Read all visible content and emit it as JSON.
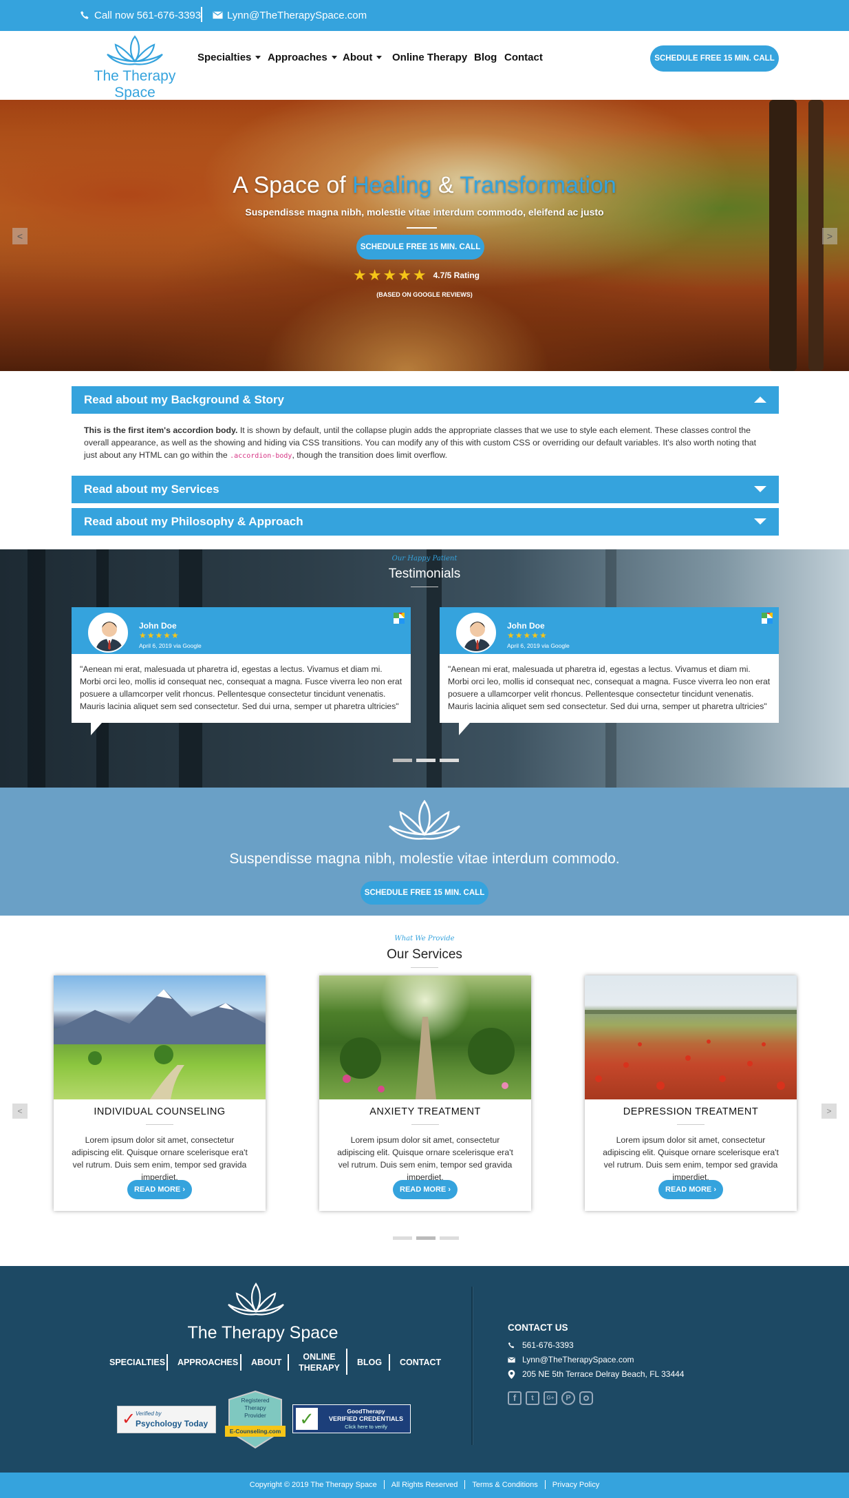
{
  "topbar": {
    "phone": "Call now 561-676-3393",
    "email": "Lynn@TheTherapySpace.com"
  },
  "header": {
    "logo_text": "The Therapy Space",
    "nav": [
      {
        "label": "Specialties",
        "dropdown": true
      },
      {
        "label": "Approaches",
        "dropdown": true
      },
      {
        "label": "About",
        "dropdown": true
      },
      {
        "label": "Online Therapy",
        "dropdown": false
      },
      {
        "label": "Blog",
        "dropdown": false
      },
      {
        "label": "Contact",
        "dropdown": false
      }
    ],
    "cta_label": "Schedule Free 15 Min. Call"
  },
  "hero": {
    "title_part1": "A Space of ",
    "title_healing": "Healing",
    "title_amp": " & ",
    "title_transformation": "Transformation",
    "subtitle": "Suspendisse magna nibh, molestie vitae interdum commodo, eleifend ac justo",
    "cta_label": "Schedule Free 15 Min. Call",
    "rating_text": "4.7/5 Rating",
    "rating_value": 4.7,
    "rating_note": "(BASED ON GOOGLE REVIEWS)"
  },
  "accordion": [
    {
      "title": "Read about my Background & Story",
      "expanded": true,
      "body_strong": "This is the first item's accordion body.",
      "body_text1": " It is shown by default, until the collapse plugin adds the appropriate classes that we use to style each element. These classes control the overall appearance, as well as the showing and hiding via CSS transitions. You can modify any of this with custom CSS or overriding our default variables. It's also worth noting that just about any HTML can go within the ",
      "body_code": ".accordion-body",
      "body_text2": ", though the transition does limit overflow."
    },
    {
      "title": "Read about my Services",
      "expanded": false
    },
    {
      "title": "Read about my Philosophy & Approach",
      "expanded": false
    }
  ],
  "testimonials": {
    "kicker": "Our Happy Patient",
    "title": "Testimonials",
    "items": [
      {
        "name": "John Doe",
        "stars": "★★★★★",
        "meta": "April 6, 2019 via Google",
        "text": "\"Aenean mi erat, malesuada ut pharetra id, egestas a lectus. Vivamus et diam mi. Morbi orci leo, mollis id consequat nec, consequat a magna. Fusce viverra leo non erat posuere a ullamcorper velit rhoncus. Pellentesque consectetur tincidunt venenatis. Mauris lacinia aliquet sem sed consectetur. Sed dui urna, semper ut pharetra ultricies\""
      },
      {
        "name": "John Doe",
        "stars": "★★★★★",
        "meta": "April 6, 2019 via Google",
        "text": "\"Aenean mi erat, malesuada ut pharetra id, egestas a lectus. Vivamus et diam mi. Morbi orci leo, mollis id consequat nec, consequat a magna. Fusce viverra leo non erat posuere a ullamcorper velit rhoncus. Pellentesque consectetur tincidunt venenatis. Mauris lacinia aliquet sem sed consectetur. Sed dui urna, semper ut pharetra ultricies\""
      }
    ]
  },
  "cta": {
    "text": "Suspendisse magna nibh, molestie vitae interdum commodo.",
    "button": "Schedule Free 15 Min. Call"
  },
  "services": {
    "kicker": "What We Provide",
    "title": "Our Services",
    "items": [
      {
        "title": "INDIVIDUAL COUNSELING",
        "text": "Lorem ipsum dolor sit amet, consectetur adipiscing elit. Quisque ornare scelerisque era't vel rutrum. Duis sem enim, tempor sed gravida imperdiet.",
        "button": "READ MORE"
      },
      {
        "title": "ANXIETY TREATMENT",
        "text": "Lorem ipsum dolor sit amet, consectetur adipiscing elit. Quisque ornare scelerisque era't vel rutrum. Duis sem enim, tempor sed gravida imperdiet.",
        "button": "READ MORE"
      },
      {
        "title": "DEPRESSION TREATMENT",
        "text": "Lorem ipsum dolor sit amet, consectetur adipiscing elit. Quisque ornare scelerisque era't vel rutrum. Duis sem enim, tempor sed gravida imperdiet.",
        "button": "READ MORE"
      }
    ]
  },
  "footer": {
    "logo_text": "The Therapy Space",
    "links": [
      "SPECIALTIES",
      "APPROACHES",
      "ABOUT",
      "ONLINE THERAPY",
      "BLOG",
      "CONTACT"
    ],
    "badges": {
      "pt_verified": "Verified by",
      "pt_name": "Psychology Today",
      "ec_line1": "Registered",
      "ec_line2": "Therapy",
      "ec_line3": "Provider",
      "ec_name": "E-Counseling.com",
      "gt_name": "GoodTherapy",
      "gt_verified": "VERIFIED CREDENTIALS",
      "gt_click": "Click here to verify"
    },
    "contact_title": "CONTACT US",
    "phone": "561-676-3393",
    "email": "Lynn@TheTherapySpace.com",
    "address": "205 NE 5th Terrace Delray Beach, FL 33444",
    "social_icons": [
      "facebook-icon",
      "twitter-icon",
      "google-plus-icon",
      "pinterest-icon",
      "instagram-icon"
    ]
  },
  "bottombar": {
    "copyright": "Copyright © 2019 The Therapy Space",
    "rights": "All Rights Reserved",
    "terms": "Terms & Conditions",
    "privacy": "Privacy Policy"
  },
  "colors": {
    "accent": "#35a3dd",
    "footer": "#1d4964",
    "cta_band": "#6aa0c6",
    "star": "#f5c518"
  }
}
